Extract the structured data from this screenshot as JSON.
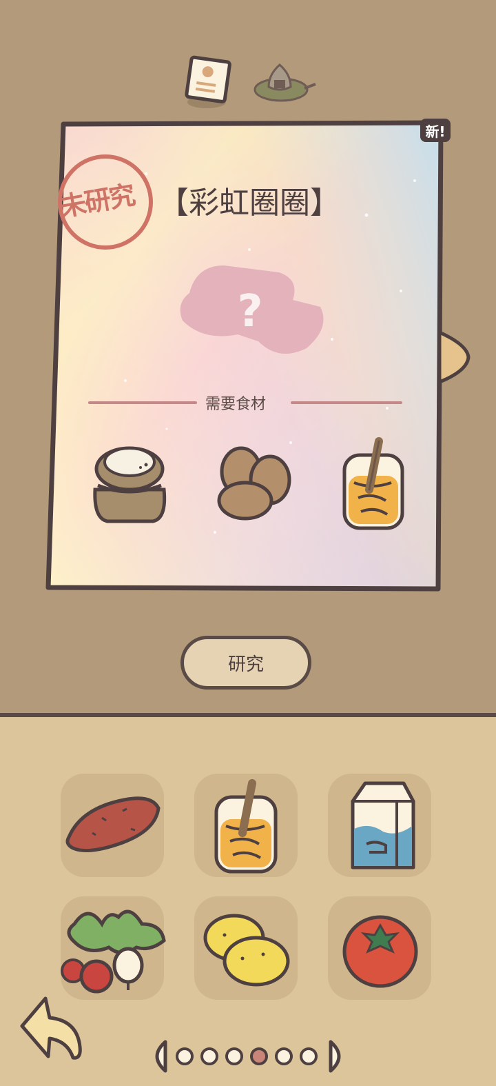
{
  "tabs": [
    {
      "name": "recipe-tab",
      "icon": "recipe-card-icon"
    },
    {
      "name": "onigiri-tab",
      "icon": "onigiri-icon"
    }
  ],
  "card": {
    "badge": "新!",
    "stamp": "未研究",
    "title": "【彩虹圈圈】",
    "mystery_mark": "?",
    "ingredients_label": "需要食材",
    "ingredients": [
      "flour-sack-icon",
      "eggs-icon",
      "honey-jar-icon"
    ]
  },
  "research_button": "研究",
  "inventory": [
    "sweet-potato-icon",
    "honey-jar-icon",
    "milk-carton-icon",
    "radish-bunch-icon",
    "lemons-icon",
    "tomato-icon"
  ],
  "pager": {
    "pages": 6,
    "current": 4
  },
  "colors": {
    "outline": "#5a4b46",
    "top_bg": "#b29a7b",
    "bottom_bg": "#dcc59a",
    "stamp": "#cf7366"
  }
}
